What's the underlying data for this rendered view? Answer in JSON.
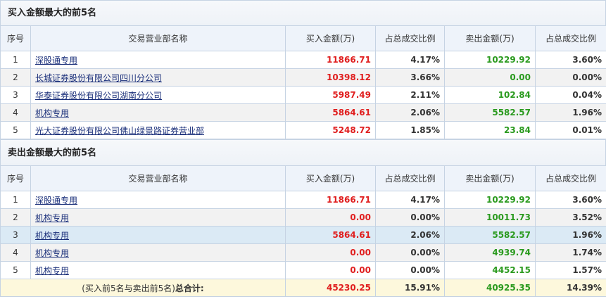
{
  "buy_section": {
    "title": "买入金额最大的前5名",
    "headers": [
      "序号",
      "交易营业部名称",
      "买入金额(万)",
      "占总成交比例",
      "卖出金额(万)",
      "占总成交比例"
    ],
    "rows": [
      {
        "idx": "1",
        "name": "深股通专用",
        "buy": "11866.71",
        "buy_pct": "4.17%",
        "sell": "10229.92",
        "sell_pct": "3.60%"
      },
      {
        "idx": "2",
        "name": "长城证券股份有限公司四川分公司",
        "buy": "10398.12",
        "buy_pct": "3.66%",
        "sell": "0.00",
        "sell_pct": "0.00%"
      },
      {
        "idx": "3",
        "name": "华泰证券股份有限公司湖南分公司",
        "buy": "5987.49",
        "buy_pct": "2.11%",
        "sell": "102.84",
        "sell_pct": "0.04%"
      },
      {
        "idx": "4",
        "name": "机构专用",
        "buy": "5864.61",
        "buy_pct": "2.06%",
        "sell": "5582.57",
        "sell_pct": "1.96%"
      },
      {
        "idx": "5",
        "name": "光大证券股份有限公司佛山绿景路证券营业部",
        "buy": "5248.72",
        "buy_pct": "1.85%",
        "sell": "23.84",
        "sell_pct": "0.01%"
      }
    ]
  },
  "sell_section": {
    "title": "卖出金额最大的前5名",
    "headers": [
      "序号",
      "交易营业部名称",
      "买入金额(万)",
      "占总成交比例",
      "卖出金额(万)",
      "占总成交比例"
    ],
    "rows": [
      {
        "idx": "1",
        "name": "深股通专用",
        "buy": "11866.71",
        "buy_pct": "4.17%",
        "sell": "10229.92",
        "sell_pct": "3.60%"
      },
      {
        "idx": "2",
        "name": "机构专用",
        "buy": "0.00",
        "buy_pct": "0.00%",
        "sell": "10011.73",
        "sell_pct": "3.52%"
      },
      {
        "idx": "3",
        "name": "机构专用",
        "buy": "5864.61",
        "buy_pct": "2.06%",
        "sell": "5582.57",
        "sell_pct": "1.96%"
      },
      {
        "idx": "4",
        "name": "机构专用",
        "buy": "0.00",
        "buy_pct": "0.00%",
        "sell": "4939.74",
        "sell_pct": "1.74%"
      },
      {
        "idx": "5",
        "name": "机构专用",
        "buy": "0.00",
        "buy_pct": "0.00%",
        "sell": "4452.15",
        "sell_pct": "1.57%"
      }
    ],
    "total": {
      "label_prefix": "(买入前5名与卖出前5名)",
      "label_strong": "总合计:",
      "buy": "45230.25",
      "buy_pct": "15.91%",
      "sell": "40925.35",
      "sell_pct": "14.39%"
    }
  },
  "colors": {
    "buy_value": "#e01e1e",
    "sell_value": "#2a9a1e",
    "link": "#1a2f7a",
    "highlight_row": "#dbeaf5",
    "total_row": "#fdf8dc"
  }
}
